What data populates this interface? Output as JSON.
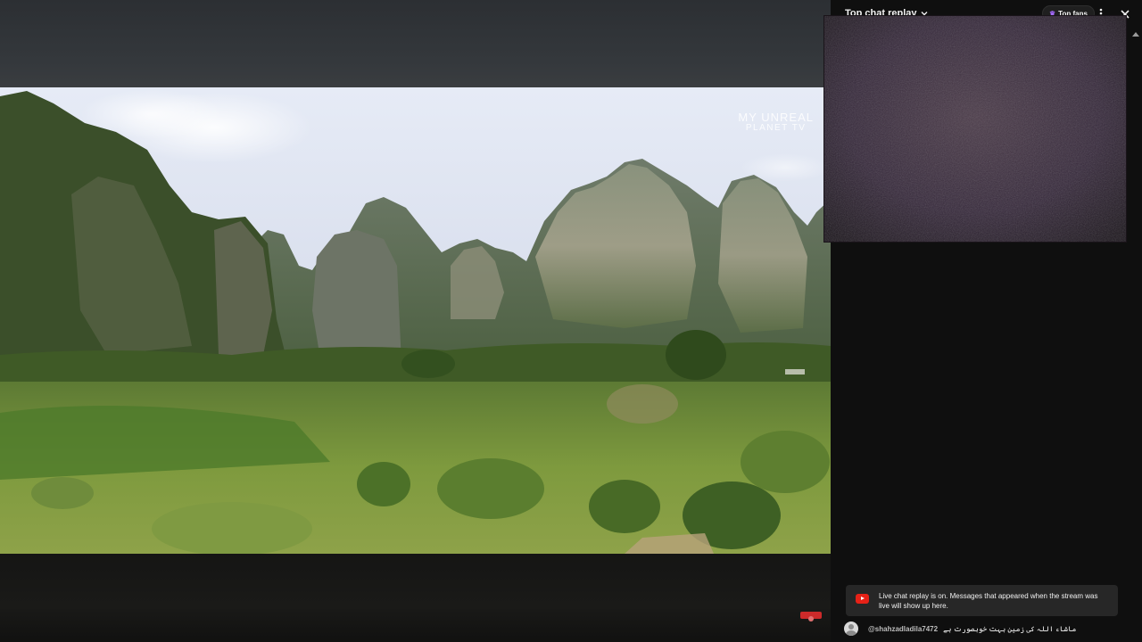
{
  "chat": {
    "title": "Top chat replay",
    "top_fans_label": "Top fans",
    "banner_text": "Live chat replay is on. Messages that appeared when the stream was live will show up here.",
    "messages": [
      {
        "author": "@shahzadladila7472",
        "text": "ماشاء اللہ کی زمین بہت خوبصورت ہے"
      }
    ]
  },
  "video": {
    "watermark_line1": "MY UNREAL",
    "watermark_line2": "PLANET TV"
  },
  "icons": {
    "title_dropdown": "chevron-down-icon",
    "top_fans": "crown-icon",
    "more": "more-vert-icon",
    "close": "close-icon",
    "banner": "youtube-icon",
    "scroll": "scroll-up-icon"
  },
  "colors": {
    "panel_bg": "#0f0f0f",
    "banner_bg": "#272727",
    "youtube_red": "#e62117",
    "overlay_bg": "#2a1f29"
  }
}
